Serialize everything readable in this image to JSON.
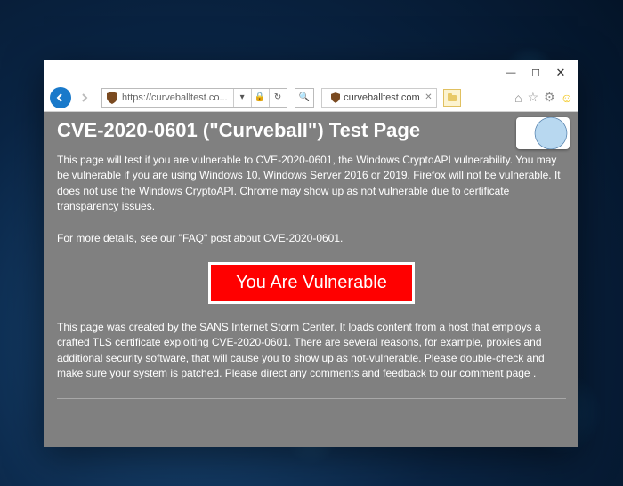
{
  "window": {
    "minimize": "—",
    "maximize": "☐",
    "close": "✕"
  },
  "nav": {
    "url_display": "https://curveballtest.co...",
    "refresh_glyph": "↻",
    "lock_glyph": "🔒",
    "search_glyph": "🔍",
    "tab_title": "curveballtest.com",
    "tab_close": "✕",
    "newtab_glyph": "",
    "home_glyph": "⌂",
    "star_glyph": "☆",
    "gear_glyph": "⚙",
    "smile_glyph": "☺"
  },
  "page": {
    "title": "CVE-2020-0601 (\"Curveball\") Test Page",
    "intro": "This page will test if you are vulnerable to CVE-2020-0601, the Windows CryptoAPI vulnerability. You may be vulnerable if you are using Windows 10, Windows Server 2016 or 2019. Firefox will not be vulnerable. It does not use the Windows CryptoAPI. Chrome may show up as not vulnerable due to certificate transparency issues.",
    "details_pre": "For more details, see ",
    "faq_link": "our \"FAQ\" post",
    "details_post": " about CVE-2020-0601.",
    "vulnerable_text": "You Are Vulnerable",
    "credit_pre": "This page was created by the SANS Internet Storm Center. It loads content from a host that employs a crafted TLS certificate exploiting CVE-2020-0601. There are several reasons, for example, proxies and additional security software, that will cause you to show up as not-vulnerable. Please double-check and make sure your system is patched. Please direct any comments and feedback to ",
    "comment_link": "our comment page",
    "credit_post": " ."
  }
}
